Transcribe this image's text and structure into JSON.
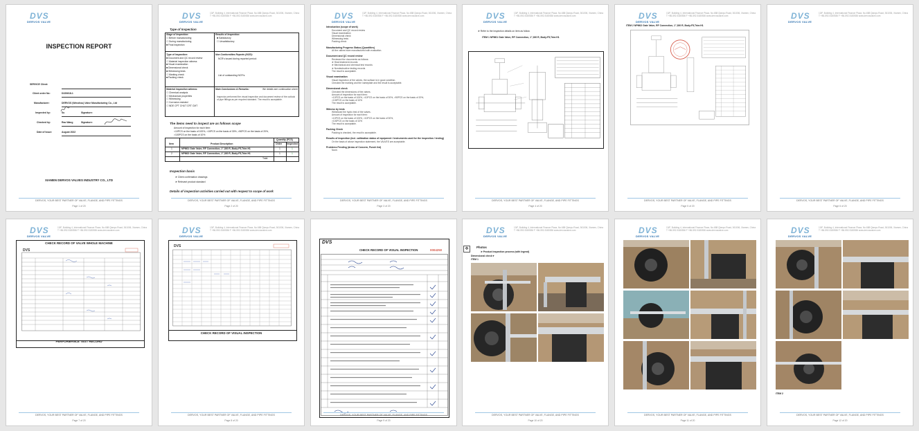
{
  "company": {
    "logo_text": "DVS",
    "logo_sub": "DERVOS VALVE",
    "address": "13/F, Building 4, International Finance Plaza, No.688 Qianpu Road, 361006, Xiamen, China",
    "contact": "T +86-592-5180536    F +86-592-5180536    www.dervosvalve.com",
    "footer": "DERVOS, YOUR BEST PARTNER OF VALVE, FLANGE, AND PIPE FITTINGS",
    "full_name": "XIAMEN DERVOS VALVES INDUSTRY CO., LTD"
  },
  "pages": {
    "p1": {
      "title": "INSPECTION REPORT",
      "fields": [
        {
          "label": "SERVICE Client:",
          "value": ""
        },
        {
          "label": "Client order No:",
          "value": "D220618-1"
        },
        {
          "label": "Manufacturer:",
          "value": "DERVOS (Wenzhou) Valve Manufacturing Co., Ltd"
        },
        {
          "label": "Inspected by:",
          "value": "Su",
          "extra_label": "Signature:"
        },
        {
          "label": "Checked by:",
          "value": "Rao Wang",
          "extra_label": "Signature:"
        },
        {
          "label": "Date of Issue:",
          "value": "August   2022"
        }
      ],
      "page_no": "Page 1 of 20"
    },
    "p2": {
      "type_heading": "Type of Inspection",
      "stage_heading": "Stage of Inspection:",
      "stage_items": [
        "Before manufacturing",
        "During manufacturing",
        "Final inspection"
      ],
      "result_heading": "Results of Inspection:",
      "result_items": [
        "Satisfactory",
        "Unsatisfactory"
      ],
      "toi_heading": "Type of Inspection:",
      "toi_items": [
        "Document and QC record review",
        "Material inspection witness",
        "Visual examination",
        "Dimensional check",
        "Witnessing tests",
        "Marking check",
        "Packing check"
      ],
      "ncr_heading": "Non Conformities Reports (NCR):",
      "ncr_items": [
        "NCR's issued during reported period:",
        "List of outstanding NCR's:"
      ],
      "mat_heading": "Material inspection witness:",
      "mat_items": [
        "Chemical analysis",
        "Mechanical properties",
        "Witnessing",
        "Corrosion resisted",
        "NDE   CPT  CHUT  CRT  CMT"
      ],
      "conc_heading": "Main Conclusions & Remarks:",
      "conc_text": "We details see continuation sheet",
      "conc_body": "Inspector performed the visual inspection and document review of the outlook of pipe fittings as per required standard. The result is acceptable.",
      "scope_heading": "The items need to inspect are as follows scope",
      "scope_intro": "Amount of inspection for each item:",
      "scope_rule1": "<10PCS on the basis of 100%,   >10PCS on the basis of 30%,   >50PCS on the basis of 20%,",
      "scope_rule2": ">100PCS on the basis of 10%",
      "table_head": [
        "Item",
        "Product Description",
        "Quantity (PCS)",
        "Order",
        "Inspected"
      ],
      "table_rows": [
        {
          "item": "1",
          "desc": "NPM01   Gate Valve, RF Connection, 1\",300 R, Body:F5,Trim:H1",
          "order": "1",
          "insp": "1"
        },
        {
          "item": "2",
          "desc": "NPM02   Gate Valve, RF Connection, 1\",300 R, Body:F5,Trim:H1",
          "order": "1",
          "insp": "1"
        }
      ],
      "table_total": "Total:",
      "basis_heading": "Inspection basis",
      "basis_items": [
        "Client confirmation drawings",
        "Relevant product standard"
      ],
      "details_heading": "Details of inspection activities carried out with respect to scope of work",
      "page_no": "Page 2 of 20"
    },
    "p3": {
      "sections": [
        {
          "h": "Introduction (scope of work)",
          "lines": [
            "Document and QC record review",
            "Visual examination",
            "Dimensional check",
            "Witnessing tests",
            "Packing check"
          ]
        },
        {
          "h": "Manufacturing Progress Status (Quantities)",
          "lines": [
            "All the valves have manufactured with evaluation."
          ]
        },
        {
          "h": "Document and QC record review",
          "lines": [
            "Reviewed the documents as follows:",
            "Heat treatment records",
            "Mechanical and chemical test records",
            "Nondestructive testing records",
            "The result is acceptable."
          ]
        },
        {
          "h": "Visual examination",
          "lines": [
            "Visual inspection of the valves, the surface is in good condition.",
            "Checked the marking and the nameplate and the result is acceptable."
          ]
        },
        {
          "h": "Dimensional check",
          "lines": [
            "Checked the dimensions of the valves.",
            "Amount of inspection for each item:",
            "<10PCS on the basis of 100%,  >10PCS on the basis of 30%,  >50PCS on the basis of 20%,",
            ">100PCS on the basis of 10%",
            "The result is acceptable."
          ]
        },
        {
          "h": "Witness by tests",
          "lines": [
            "Witnessed the hydro test of the valves.",
            "Amount of inspection for each item:",
            "<10PCS on the basis of 100%,  >10PCS on the basis of 30%,",
            ">100PCS on the basis of 10%",
            "The result is acceptable."
          ]
        },
        {
          "h": "Packing Check",
          "lines": [
            "Packing is checked, the result is acceptable."
          ]
        },
        {
          "h": "Results of inspection (incl. calibration status of equipment / instruments used for the inspection / testing)",
          "lines": [
            "On the basis of above inspection statement, the VALVES are acceptable."
          ]
        },
        {
          "h": "Problems Pending (Areas of Concern, Punch list)",
          "lines": [
            "None."
          ]
        }
      ],
      "page_no": "Page 3 of 20"
    },
    "p4": {
      "note": "Refer to the inspection details on item as follow.",
      "item_caption": "ITEM 1   NPM01   Gate Valve, RF Connection, 1\",300 R, Body:F5,Trim:H1",
      "page_no": "Page 4 of 20"
    },
    "p5": {
      "item_caption": "ITEM 2   NPM02   Gate Valve, RF Connection, 1\",300 R, Body:F5,Trim:H1",
      "page_no": "Page 5 of 20"
    },
    "p6": {
      "page_no": "Page 6 of 20"
    },
    "p7": {
      "top_caption": "CHECK RECORD OF VALVE WHOLE MACHINE",
      "bottom_caption": "PERFORMANCE TEST RECORD",
      "page_no": "Page 7 of 20"
    },
    "p8": {
      "caption": "CHECK RECORD OF VISUAL INSPECTION",
      "page_no": "Page 8 of 20"
    },
    "p9": {
      "form_title": "CHECK RECORD OF VISUAL INSPECTION",
      "serial": "0004250",
      "page_no": "Page 9 of 20"
    },
    "p10": {
      "photos_heading": "Photos",
      "photos_sub": "Product inspection process (with legend)",
      "dim_check": "Dimensional check",
      "item": "ITEM 1",
      "page_no": "Page 10 of 20"
    },
    "p11": {
      "page_no": "Page 11 of 20"
    },
    "p12": {
      "item": "ITEM 2",
      "page_no": "Page 12 of 20"
    }
  },
  "colors": {
    "logo": "#7fb3d6",
    "footer_line": "#9ec6e4",
    "stamp": "#d65a4a",
    "check": "#2e9b3c"
  }
}
